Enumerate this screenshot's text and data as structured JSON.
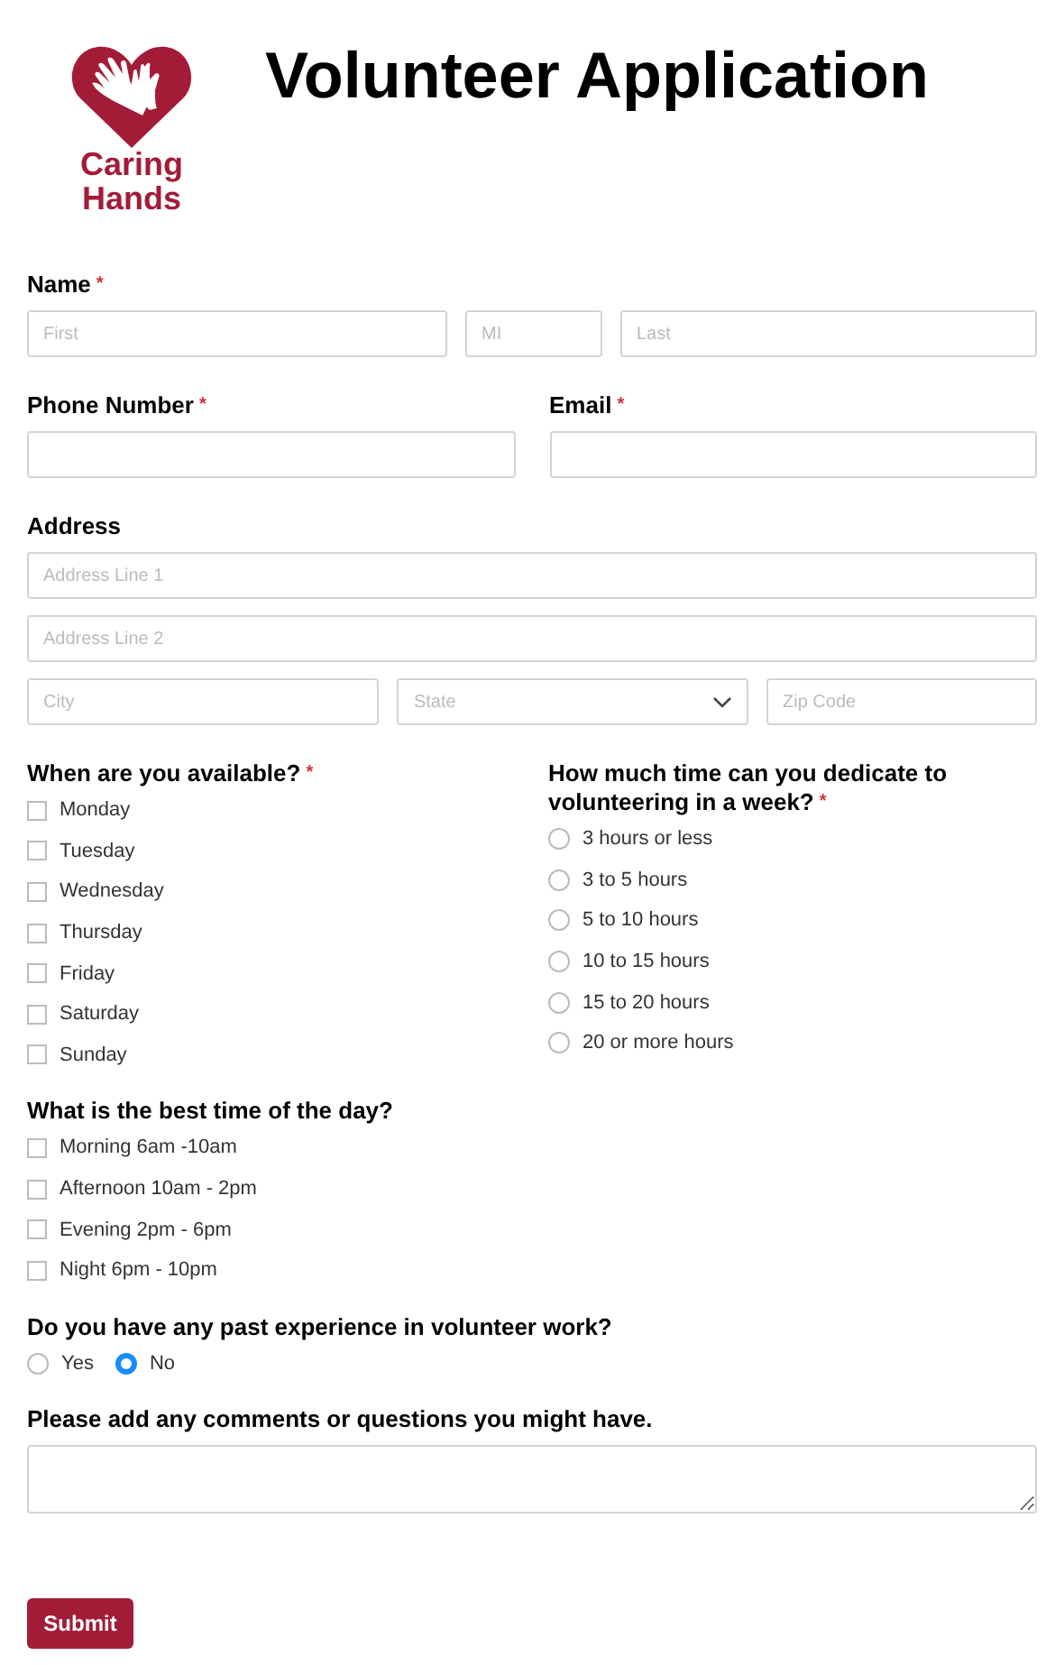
{
  "logo": {
    "lines": [
      "Caring",
      "Hands"
    ]
  },
  "title": "Volunteer Application",
  "required_mark": "*",
  "name": {
    "label": "Name",
    "required": true,
    "placeholders": [
      "First",
      "MI",
      "Last"
    ]
  },
  "phone": {
    "label": "Phone Number",
    "required": true
  },
  "email": {
    "label": "Email",
    "required": true
  },
  "address": {
    "label": "Address",
    "required": false,
    "line1": {
      "placeholder": "Address Line 1"
    },
    "line2": {
      "placeholder": "Address Line 2"
    },
    "city": {
      "placeholder": "City"
    },
    "state": {
      "placeholder": "State"
    },
    "zip": {
      "placeholder": "Zip Code"
    }
  },
  "availability": {
    "label": "When are you available?",
    "required": true,
    "options": [
      {
        "label": "Monday",
        "checked": false
      },
      {
        "label": "Tuesday",
        "checked": false
      },
      {
        "label": "Wednesday",
        "checked": false
      },
      {
        "label": "Thursday",
        "checked": false
      },
      {
        "label": "Friday",
        "checked": false
      },
      {
        "label": "Saturday",
        "checked": false
      },
      {
        "label": "Sunday",
        "checked": false
      }
    ]
  },
  "hours": {
    "label": "How much time can you dedicate to volunteering in a week?",
    "required": true,
    "options": [
      {
        "label": "3 hours or less",
        "selected": false
      },
      {
        "label": "3 to 5 hours",
        "selected": false
      },
      {
        "label": "5 to 10 hours",
        "selected": false
      },
      {
        "label": "10 to 15 hours",
        "selected": false
      },
      {
        "label": "15 to 20 hours",
        "selected": false
      },
      {
        "label": "20 or more hours",
        "selected": false
      }
    ]
  },
  "time_of_day": {
    "label": "What is the best time of the day?",
    "required": false,
    "options": [
      {
        "label": "Morning 6am -10am",
        "checked": false
      },
      {
        "label": "Afternoon 10am - 2pm",
        "checked": false
      },
      {
        "label": "Evening 2pm - 6pm",
        "checked": false
      },
      {
        "label": "Night 6pm - 10pm",
        "checked": false
      }
    ]
  },
  "experience": {
    "label": "Do you have any past experience in volunteer work?",
    "required": false,
    "options": [
      {
        "label": "Yes",
        "selected": false
      },
      {
        "label": "No",
        "selected": true
      }
    ]
  },
  "comments": {
    "label": "Please add any comments or questions you might have."
  },
  "submit": "Submit"
}
